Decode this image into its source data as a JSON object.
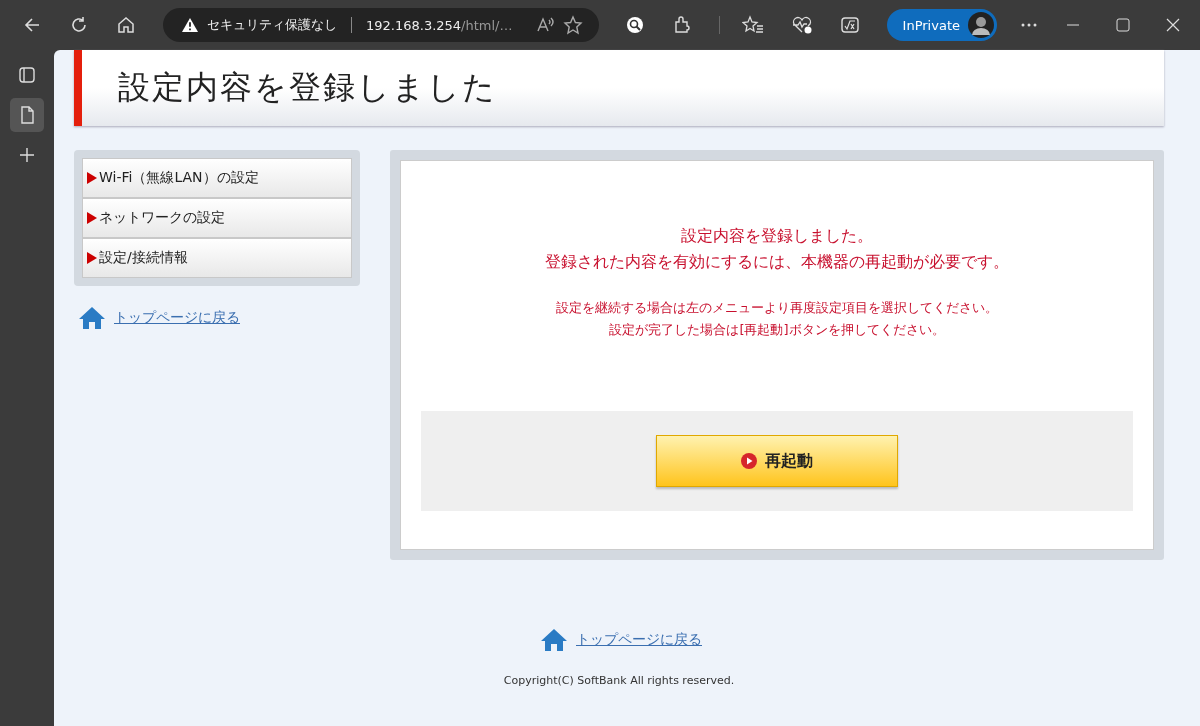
{
  "browser": {
    "security_label": "セキュリティ保護なし",
    "url_host": "192.168.3.254",
    "url_path": "/html/…",
    "inprivate_label": "InPrivate",
    "vertical_tabs": [
      {
        "kind": "tab-actions",
        "selected": false
      },
      {
        "kind": "page",
        "selected": true
      },
      {
        "kind": "new-tab",
        "selected": false
      }
    ]
  },
  "page_title": "設定内容を登録しました",
  "menu": [
    {
      "label": "Wi-Fi（無線LAN）の設定"
    },
    {
      "label": "ネットワークの設定"
    },
    {
      "label": "設定/接続情報"
    }
  ],
  "side_link": "トップページに戻る",
  "message": {
    "headline": [
      "設定内容を登録しました。",
      "登録された内容を有効にするには、本機器の再起動が必要です。"
    ],
    "notes": [
      "設定を継続する場合は左のメニューより再度設定項目を選択してください。",
      "設定が完了した場合は[再起動]ボタンを押してください。"
    ]
  },
  "restart_button": "再起動",
  "footer_link": "トップページに戻る",
  "copyright": "Copyright(C) SoftBank All rights reserved."
}
